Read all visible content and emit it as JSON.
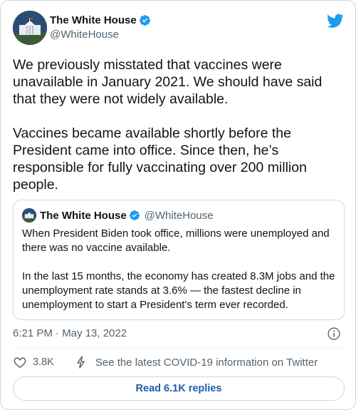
{
  "colors": {
    "text": "#0f1419",
    "secondary": "#536471",
    "twitter_blue": "#1d9bf0",
    "border": "#cfd9de",
    "link": "#1d5fa8"
  },
  "tweet": {
    "author": {
      "name": "The White House",
      "handle": "@WhiteHouse",
      "verified_icon": "verified-badge-icon",
      "avatar_icon": "white-house-avatar"
    },
    "platform_icon": "twitter-bird-icon",
    "text": "We previously misstated that vaccines were\nunavailable in January 2021. We should have said\nthat they were not widely available.\n\nVaccines became available shortly before the\nPresident came into office. Since then, he’s\nresponsible for fully vaccinating over 200 million\npeople.",
    "quoted_tweet": {
      "author_name": "The White House",
      "author_handle": "@WhiteHouse",
      "text": "When President Biden took office, millions were unemployed and\nthere was no vaccine available.\n\nIn the last 15 months, the economy has created 8.3M jobs and the\nunemployment rate stands at 3.6% — the fastest decline in\nunemployment to start a President's term ever recorded."
    },
    "timestamp": "6:21 PM · May 13, 2022",
    "info_icon": "info-icon",
    "actions": {
      "like_icon": "heart-icon",
      "like_count": "3.8K",
      "covid_icon": "lightning-icon",
      "covid_text": "See the latest COVID-19 information on Twitter"
    },
    "read_replies_label": "Read 6.1K replies"
  }
}
